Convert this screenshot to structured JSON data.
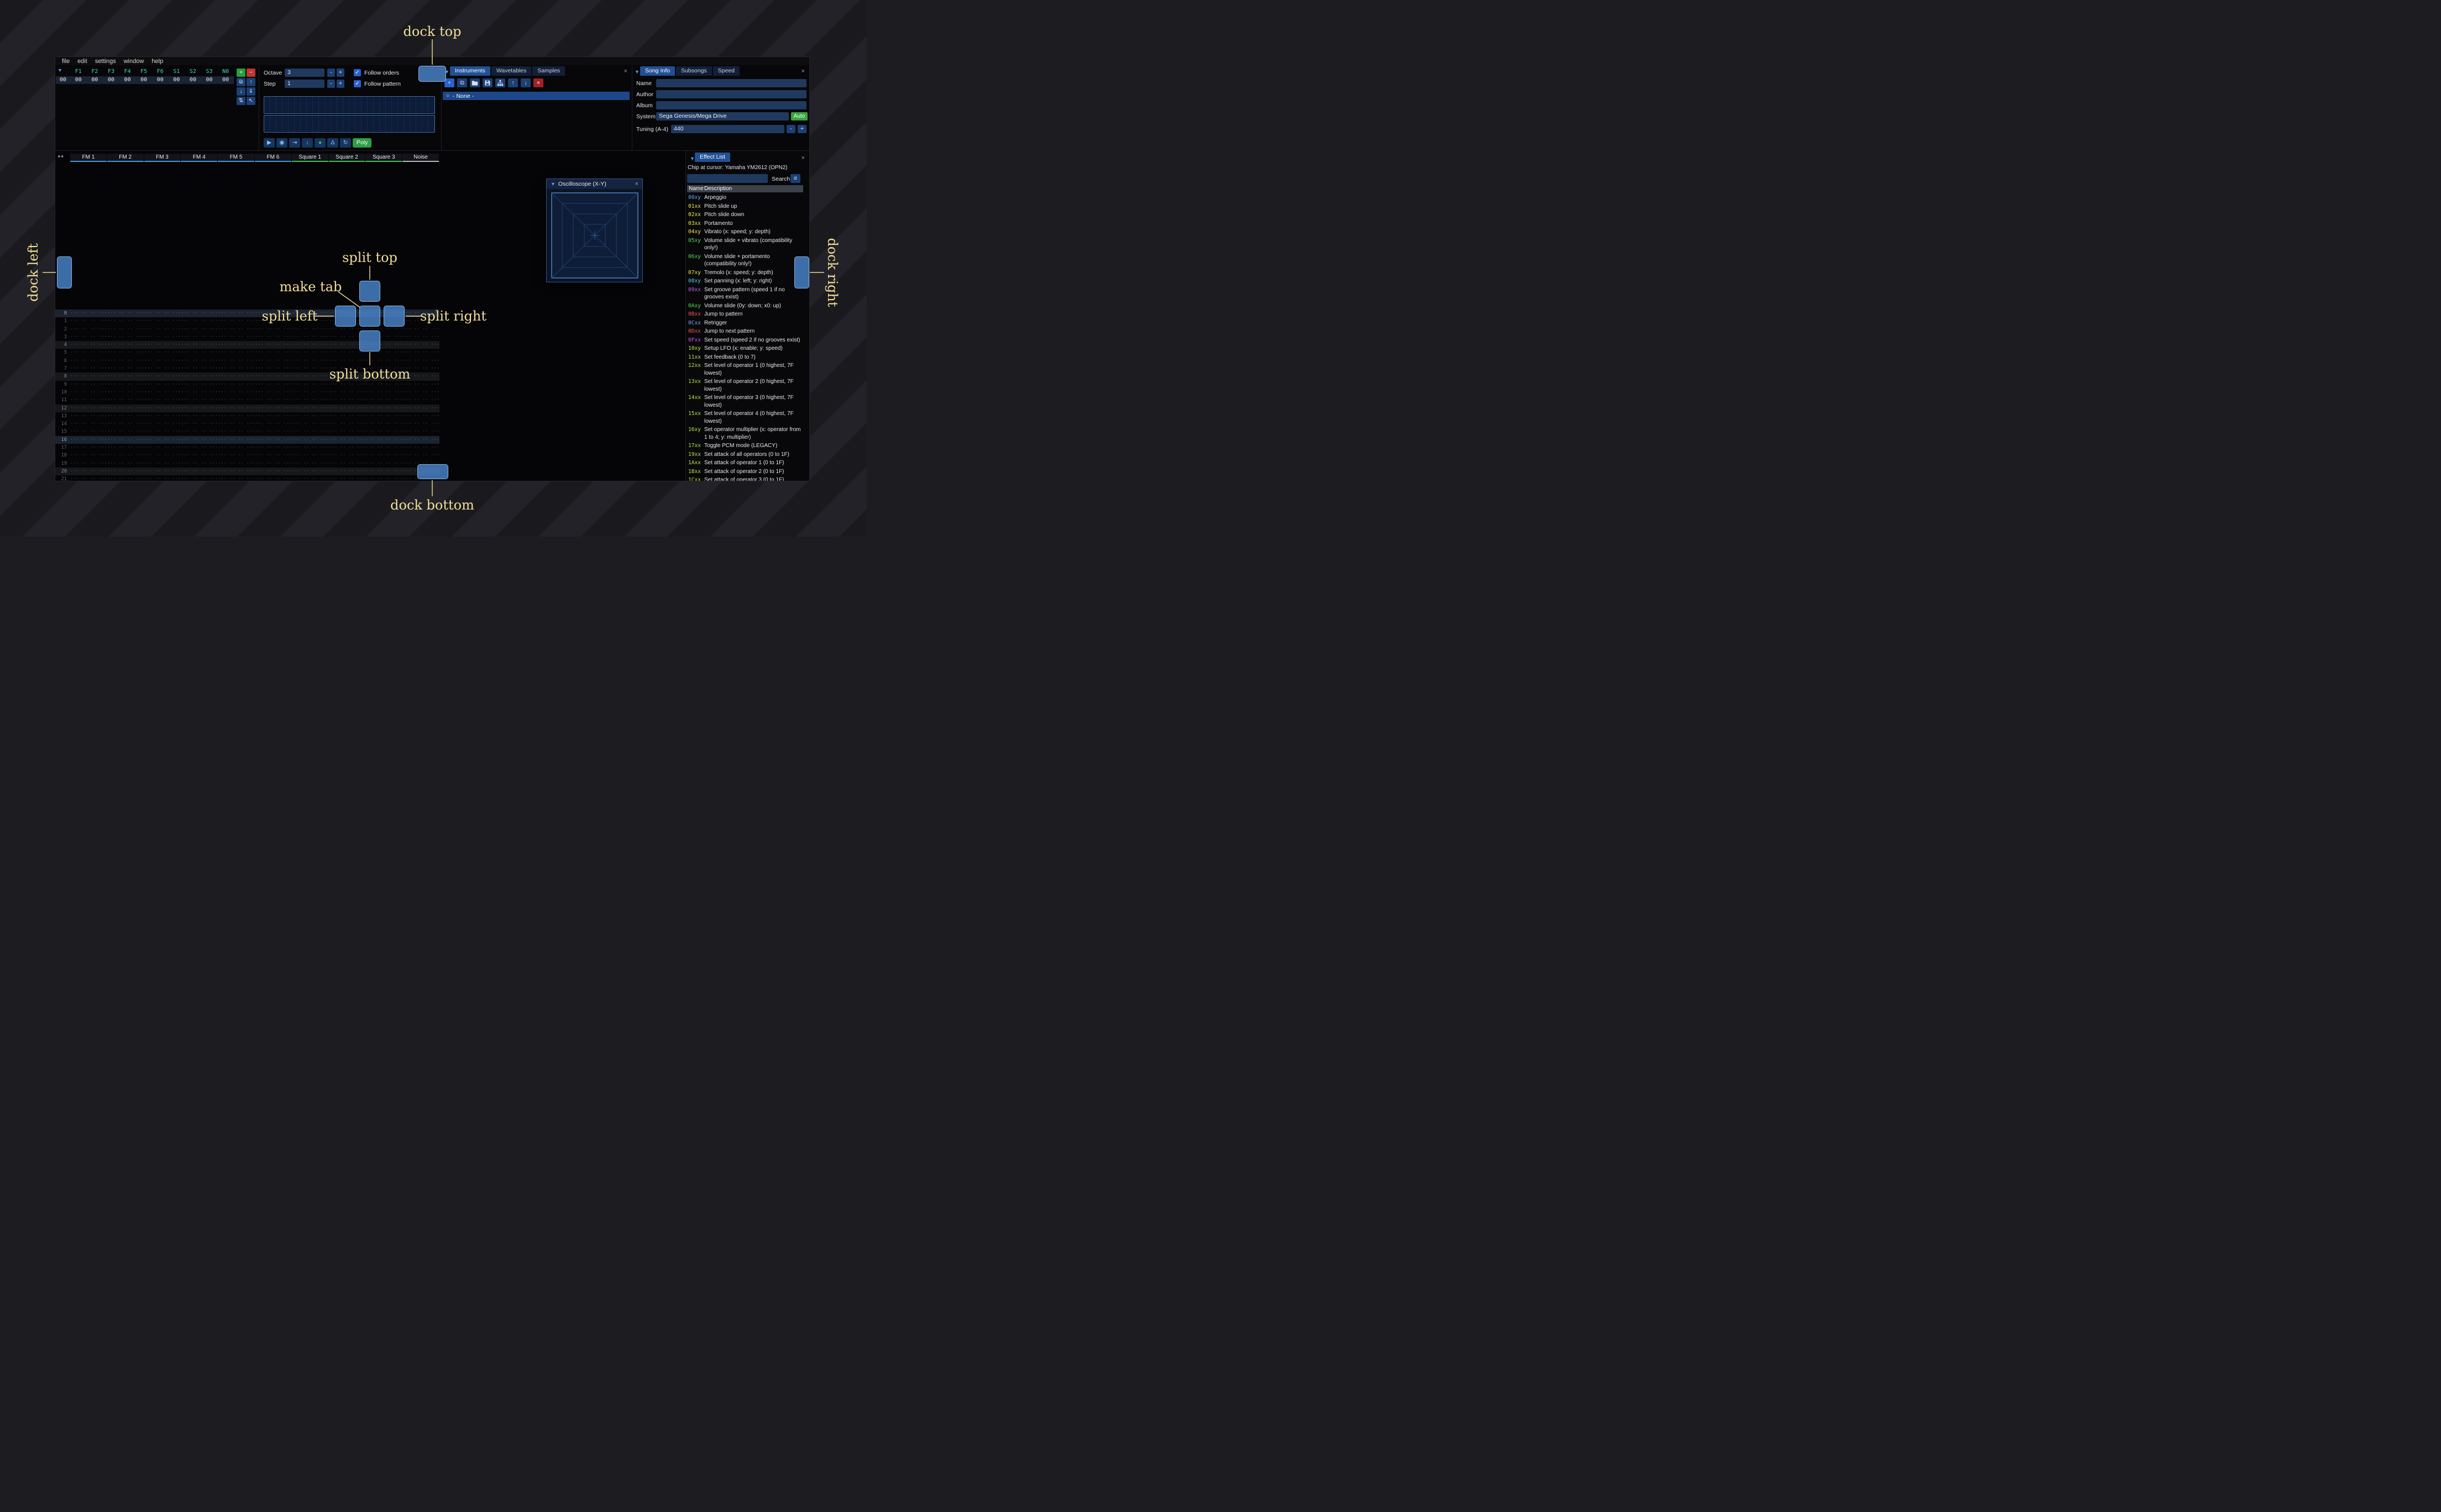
{
  "ui": {
    "close_glyph": "×",
    "collapse_glyph": "▼",
    "radio_glyph": "○",
    "hamburger_glyph": "≡",
    "checkbox_check": "✓",
    "minus_glyph": "-",
    "plus_glyph": "+"
  },
  "menu": {
    "items": [
      "file",
      "edit",
      "settings",
      "window",
      "help"
    ]
  },
  "orders": {
    "channels": [
      "F1",
      "F2",
      "F3",
      "F4",
      "F5",
      "F6",
      "S1",
      "S2",
      "S3",
      "N0"
    ],
    "channel_color": "#45d6b0",
    "current_row": {
      "index": "00",
      "values": [
        "00",
        "00",
        "00",
        "00",
        "00",
        "00",
        "00",
        "00",
        "00",
        "00"
      ]
    },
    "buttons": [
      {
        "name": "add-order-button",
        "glyph": "+",
        "bg": "#27a03a"
      },
      {
        "name": "remove-order-button",
        "glyph": "−",
        "bg": "#c03636"
      },
      {
        "name": "duplicate-order-button",
        "glyph": "⧉"
      },
      {
        "name": "move-order-up-button",
        "glyph": "↑"
      },
      {
        "name": "move-order-down-button",
        "glyph": "↓"
      },
      {
        "name": "duplicate-order-end-button",
        "glyph": "⇓"
      },
      {
        "name": "order-change-mode-button",
        "glyph": "⇅"
      },
      {
        "name": "order-edit-mode-button",
        "glyph": "↖"
      }
    ]
  },
  "play_controls": {
    "octave_label": "Octave",
    "octave_value": "3",
    "step_label": "Step",
    "step_value": "1",
    "follow_orders_label": "Follow orders",
    "follow_pattern_label": "Follow pattern",
    "buttons": [
      {
        "name": "play-button",
        "glyph": "▶"
      },
      {
        "name": "play-pattern-button",
        "glyph": "◉"
      },
      {
        "name": "play-one-row-button",
        "glyph": "⇥"
      },
      {
        "name": "stop-button",
        "glyph": "↓"
      },
      {
        "name": "edit-record-toggle",
        "glyph": "●",
        "color": "#35c846"
      },
      {
        "name": "metronome-toggle",
        "glyph": "Δ"
      },
      {
        "name": "repeat-pattern-toggle",
        "glyph": "↻"
      }
    ],
    "poly_label": "Poly"
  },
  "assets": {
    "tabs": [
      {
        "label": "Instruments",
        "active": true
      },
      {
        "label": "Wavetables",
        "active": false
      },
      {
        "label": "Samples",
        "active": false
      }
    ],
    "toolbar": [
      {
        "name": "add-instrument-button",
        "glyph": "+",
        "bg": "#2a62cc"
      },
      {
        "name": "duplicate-instrument-button",
        "glyph": "⧉"
      },
      {
        "name": "open-instrument-button",
        "icon": "folder"
      },
      {
        "name": "save-instrument-button",
        "icon": "floppy"
      },
      {
        "name": "organize-instruments-button",
        "icon": "sitemap"
      },
      {
        "name": "move-instrument-up-button",
        "glyph": "↑"
      },
      {
        "name": "move-instrument-down-button",
        "glyph": "↓"
      },
      {
        "name": "delete-instrument-button",
        "glyph": "×",
        "bg": "#a32125",
        "fg": "#ffffff"
      }
    ],
    "selected_item": "- None -"
  },
  "song_info": {
    "tabs": [
      {
        "label": "Song Info",
        "active": true
      },
      {
        "label": "Subsongs",
        "active": false
      },
      {
        "label": "Speed",
        "active": false
      }
    ],
    "name_label": "Name",
    "name_value": "",
    "author_label": "Author",
    "author_value": "",
    "album_label": "Album",
    "album_value": "",
    "system_label": "System",
    "system_value": "Sega Genesis/Mega Drive",
    "auto_label": "Auto",
    "tuning_label": "Tuning (A-4)",
    "tuning_value": "440"
  },
  "pattern": {
    "corner_label": "++",
    "channels": [
      {
        "name": "FM 1",
        "color": "#3d9ae8"
      },
      {
        "name": "FM 2",
        "color": "#3d9ae8"
      },
      {
        "name": "FM 3",
        "color": "#3d9ae8"
      },
      {
        "name": "FM 4",
        "color": "#3d9ae8"
      },
      {
        "name": "FM 5",
        "color": "#3d9ae8"
      },
      {
        "name": "FM 6",
        "color": "#3d9ae8"
      },
      {
        "name": "Square 1",
        "color": "#3fc24b"
      },
      {
        "name": "Square 2",
        "color": "#3fc24b"
      },
      {
        "name": "Square 3",
        "color": "#3fc24b"
      },
      {
        "name": "Noise",
        "color": "#b5bac0"
      }
    ],
    "row_numbers": [
      "0",
      "1",
      "2",
      "3",
      "4",
      "5",
      "6",
      "7",
      "8",
      "9",
      "10",
      "11",
      "12",
      "13",
      "14",
      "15",
      "16",
      "17",
      "18",
      "19",
      "20",
      "21"
    ],
    "highlight_major": [
      0,
      16
    ],
    "highlight_minor": [
      4,
      8,
      12,
      20
    ],
    "empty_cell": "··· ·· ·· ···"
  },
  "oscilloscope": {
    "title": "Oscilloscope (X-Y)"
  },
  "effect_list": {
    "title": "Effect List",
    "chip_line": "Chip at cursor: Yamaha YM2612 (OPN2)",
    "search_value": "",
    "search_label": "Search",
    "columns": [
      "Name",
      "Description"
    ],
    "effects": [
      {
        "code": "00xy",
        "color": "#55aaf0",
        "desc": "Arpeggio"
      },
      {
        "code": "01xx",
        "color": "#e8e84e",
        "desc": "Pitch slide up"
      },
      {
        "code": "02xx",
        "color": "#e8e84e",
        "desc": "Pitch slide down"
      },
      {
        "code": "03xx",
        "color": "#e8e84e",
        "desc": "Portamento"
      },
      {
        "code": "04xy",
        "color": "#e8e84e",
        "desc": "Vibrato (x: speed; y: depth)"
      },
      {
        "code": "05xy",
        "color": "#52d952",
        "desc": "Volume slide + vibrato (compatibility only!)"
      },
      {
        "code": "06xy",
        "color": "#52d952",
        "desc": "Volume slide + portamento (compatibility only!)"
      },
      {
        "code": "07xy",
        "color": "#e8e84e",
        "desc": "Tremolo (x: speed; y: depth)"
      },
      {
        "code": "08xy",
        "color": "#55c8f0",
        "desc": "Set panning (x: left; y: right)"
      },
      {
        "code": "09xx",
        "color": "#c45ae0",
        "desc": "Set groove pattern (speed 1 if no grooves exist)"
      },
      {
        "code": "0Axy",
        "color": "#52d952",
        "desc": "Volume slide (0y: down; x0: up)"
      },
      {
        "code": "0Bxx",
        "color": "#ee5555",
        "desc": "Jump to pattern"
      },
      {
        "code": "0Cxx",
        "color": "#7aa2f2",
        "desc": "Retrigger"
      },
      {
        "code": "0Dxx",
        "color": "#ee5555",
        "desc": "Jump to next pattern"
      },
      {
        "code": "0Fxx",
        "color": "#c45ae0",
        "desc": "Set speed (speed 2 if no grooves exist)"
      },
      {
        "code": "10xy",
        "color": "#b3e04e",
        "desc": "Setup LFO (x: enable; y: speed)"
      },
      {
        "code": "11xx",
        "color": "#b3e04e",
        "desc": "Set feedback (0 to 7)"
      },
      {
        "code": "12xx",
        "color": "#b3e04e",
        "desc": "Set level of operator 1 (0 highest, 7F lowest)"
      },
      {
        "code": "13xx",
        "color": "#b3e04e",
        "desc": "Set level of operator 2 (0 highest, 7F lowest)"
      },
      {
        "code": "14xx",
        "color": "#b3e04e",
        "desc": "Set level of operator 3 (0 highest, 7F lowest)"
      },
      {
        "code": "15xx",
        "color": "#b3e04e",
        "desc": "Set level of operator 4 (0 highest, 7F lowest)"
      },
      {
        "code": "16xy",
        "color": "#b3e04e",
        "desc": "Set operator multiplier (x: operator from 1 to 4; y: multiplier)"
      },
      {
        "code": "17xx",
        "color": "#b3e04e",
        "desc": "Toggle PCM mode (LEGACY)"
      },
      {
        "code": "19xx",
        "color": "#b3e04e",
        "desc": "Set attack of all operators (0 to 1F)"
      },
      {
        "code": "1Axx",
        "color": "#b3e04e",
        "desc": "Set attack of operator 1 (0 to 1F)"
      },
      {
        "code": "1Bxx",
        "color": "#b3e04e",
        "desc": "Set attack of operator 2 (0 to 1F)"
      },
      {
        "code": "1Cxx",
        "color": "#b3e04e",
        "desc": "Set attack of operator 3 (0 to 1F)"
      }
    ]
  },
  "dock_overlay": {
    "labels": {
      "dock_top": "dock top",
      "dock_left": "dock left",
      "dock_right": "dock right",
      "dock_bottom": "dock bottom",
      "split_top": "split top",
      "split_left": "split left",
      "split_right": "split right",
      "split_bottom": "split bottom",
      "make_tab": "make tab"
    }
  }
}
